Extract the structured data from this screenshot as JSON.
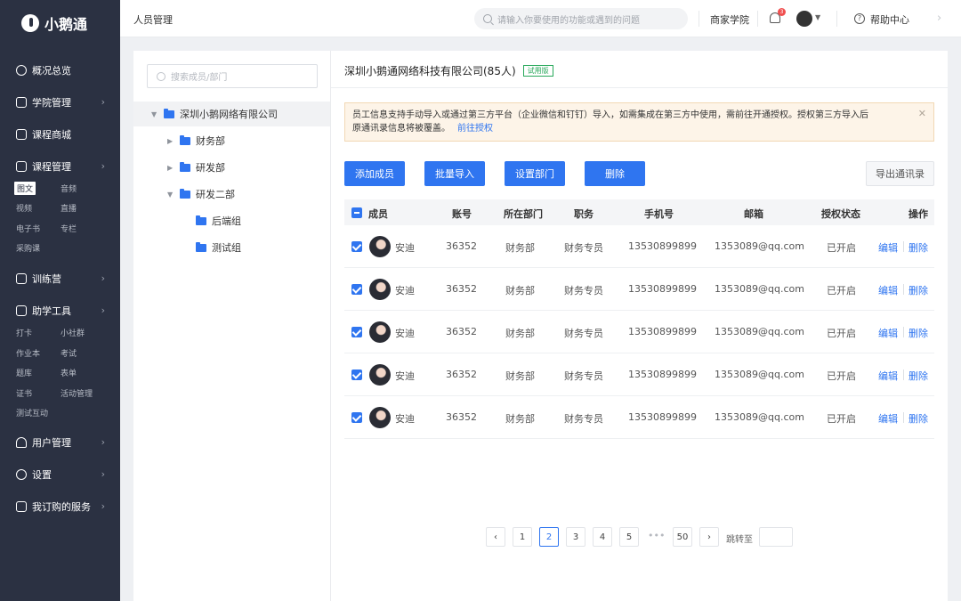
{
  "brand": {
    "name": "小鹅通"
  },
  "nav": {
    "items": [
      {
        "label": "概况总览",
        "icon": "pie-chart-icon"
      },
      {
        "label": "学院管理",
        "icon": "school-icon"
      },
      {
        "label": "课程商城",
        "icon": "book-icon"
      },
      {
        "label": "课程管理",
        "icon": "document-icon"
      },
      {
        "label": "训练营",
        "icon": "training-icon"
      },
      {
        "label": "助学工具",
        "icon": "toolbox-icon"
      },
      {
        "label": "用户管理",
        "icon": "user-icon"
      },
      {
        "label": "设置",
        "icon": "settings-icon"
      },
      {
        "label": "我订购的服务",
        "icon": "cart-icon"
      }
    ],
    "course_sub": [
      "图文",
      "音频",
      "视频",
      "直播",
      "电子书",
      "专栏",
      "采购课"
    ],
    "tools_sub": [
      "打卡",
      "小社群",
      "作业本",
      "考试",
      "题库",
      "表单",
      "证书",
      "活动管理",
      "测试互动"
    ]
  },
  "topbar": {
    "title": "人员管理",
    "search_placeholder": "请输入你要使用的功能或遇到的问题",
    "academy": "商家学院",
    "notif_count": "3",
    "help": "帮助中心"
  },
  "tree": {
    "search_placeholder": "搜索成员/部门",
    "nodes": [
      {
        "label": "深圳小鹅网络有限公司"
      },
      {
        "label": "财务部"
      },
      {
        "label": "研发部"
      },
      {
        "label": "研发二部"
      },
      {
        "label": "后端组"
      },
      {
        "label": "测试组"
      }
    ]
  },
  "main": {
    "company": "深圳小鹅通网络科技有限公司(85人)",
    "trial_badge": "试用版",
    "notice_line1": "员工信息支持手动导入或通过第三方平台（企业微信和钉钉）导入，如需集成在第三方中使用，需前往开通授权。授权第三方导入后",
    "notice_line2": "原通讯录信息将被覆盖。",
    "notice_link": "前往授权",
    "buttons": [
      "添加成员",
      "批量导入",
      "设置部门",
      "删除"
    ],
    "export_button": "导出通讯录",
    "columns": [
      "成员",
      "账号",
      "所在部门",
      "职务",
      "手机号",
      "邮箱",
      "授权状态",
      "操作"
    ],
    "rows": [
      {
        "name": "安迪",
        "account": "36352",
        "dept": "财务部",
        "role": "财务专员",
        "phone": "13530899899",
        "email": "1353089@qq.com",
        "status": "已开启"
      },
      {
        "name": "安迪",
        "account": "36352",
        "dept": "财务部",
        "role": "财务专员",
        "phone": "13530899899",
        "email": "1353089@qq.com",
        "status": "已开启"
      },
      {
        "name": "安迪",
        "account": "36352",
        "dept": "财务部",
        "role": "财务专员",
        "phone": "13530899899",
        "email": "1353089@qq.com",
        "status": "已开启"
      },
      {
        "name": "安迪",
        "account": "36352",
        "dept": "财务部",
        "role": "财务专员",
        "phone": "13530899899",
        "email": "1353089@qq.com",
        "status": "已开启"
      },
      {
        "name": "安迪",
        "account": "36352",
        "dept": "财务部",
        "role": "财务专员",
        "phone": "13530899899",
        "email": "1353089@qq.com",
        "status": "已开启"
      }
    ],
    "edit_label": "编辑",
    "delete_label": "删除",
    "pagination": {
      "pages": [
        "1",
        "2",
        "3",
        "4",
        "5"
      ],
      "current": "2",
      "ellipsis": "•••",
      "last": "50",
      "prev": "‹",
      "next": "›",
      "jump_label": "跳转至"
    }
  },
  "colors": {
    "sidebar": "#2b3142",
    "primary": "#2f75f0",
    "notice_bg": "#fdf4e8",
    "trial": "#27a85a"
  }
}
